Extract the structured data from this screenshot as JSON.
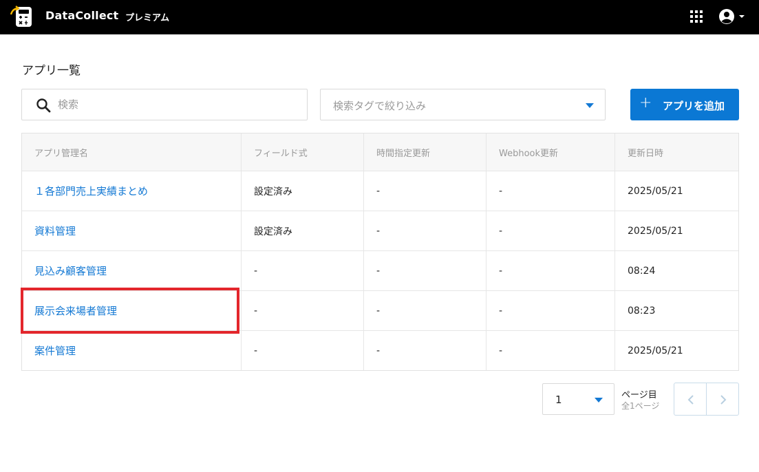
{
  "header": {
    "brand": "DataCollect",
    "plan": "プレミアム",
    "logo_icon": "calculator-icon",
    "apps_icon": "grid-icon",
    "user_icon": "account-circle-icon"
  },
  "page": {
    "title": "アプリ一覧"
  },
  "search": {
    "placeholder": "検索",
    "value": ""
  },
  "tag_filter": {
    "placeholder": "検索タグで絞り込み"
  },
  "add_button": {
    "label": "アプリを追加"
  },
  "table": {
    "columns": [
      "アプリ管理名",
      "フィールド式",
      "時間指定更新",
      "Webhook更新",
      "更新日時"
    ],
    "rows": [
      {
        "name": "１各部門売上実績まとめ",
        "field": "設定済み",
        "scheduled": "-",
        "webhook": "-",
        "updated": "2025/05/21"
      },
      {
        "name": "資料管理",
        "field": "設定済み",
        "scheduled": "-",
        "webhook": "-",
        "updated": "2025/05/21"
      },
      {
        "name": "見込み顧客管理",
        "field": "-",
        "scheduled": "-",
        "webhook": "-",
        "updated": "08:24"
      },
      {
        "name": "展示会来場者管理",
        "field": "-",
        "scheduled": "-",
        "webhook": "-",
        "updated": "08:23"
      },
      {
        "name": "案件管理",
        "field": "-",
        "scheduled": "-",
        "webhook": "-",
        "updated": "2025/05/21"
      }
    ]
  },
  "pagination": {
    "current_page": "1",
    "page_suffix": "ページ目",
    "total_pages": "全1ページ"
  },
  "colors": {
    "accent": "#0b78d4",
    "link": "#1479d4",
    "highlight": "#e3262c",
    "topbar": "#000000"
  }
}
